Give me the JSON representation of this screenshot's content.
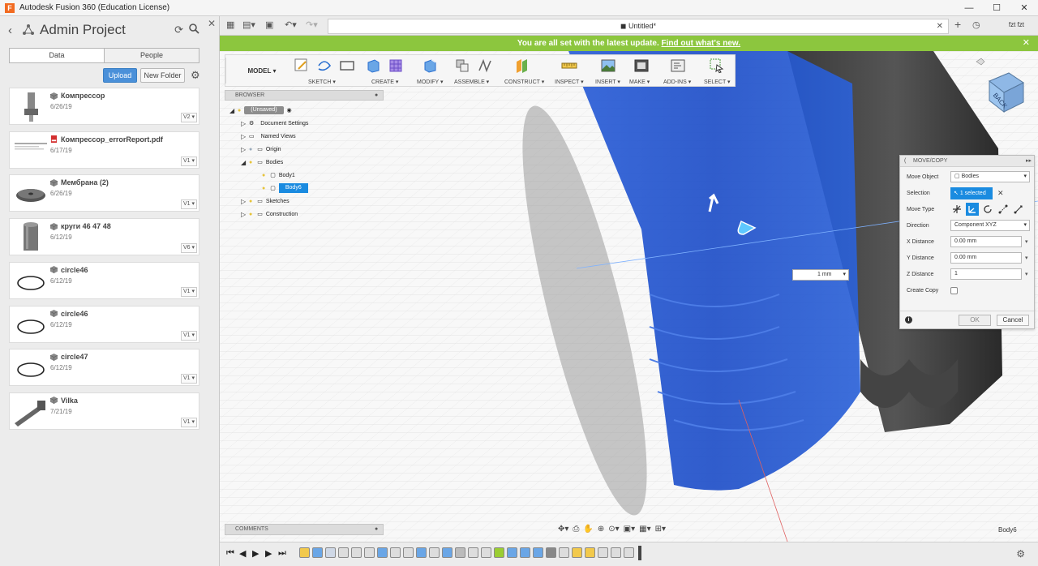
{
  "window": {
    "title": "Autodesk Fusion 360 (Education License)",
    "app_logo": "F",
    "controls": [
      "—",
      "☐",
      "✕"
    ]
  },
  "data_panel": {
    "project_title": "Admin Project",
    "close_glyph": "✕",
    "tabs": [
      {
        "label": "Data",
        "active": true
      },
      {
        "label": "People",
        "active": false
      }
    ],
    "upload_label": "Upload",
    "new_folder_label": "New Folder",
    "files": [
      {
        "name": "Компрессор",
        "date": "6/26/19",
        "version": "V2 ▾",
        "kind": "design",
        "thumb": "compressor"
      },
      {
        "name": "Компрессор_errorReport.pdf",
        "date": "6/17/19",
        "version": "V1 ▾",
        "kind": "pdf",
        "thumb": "report"
      },
      {
        "name": "Мембрана (2)",
        "date": "6/26/19",
        "version": "V1 ▾",
        "kind": "design",
        "thumb": "membrane"
      },
      {
        "name": "круги 46 47 48",
        "date": "6/12/19",
        "version": "V6 ▾",
        "kind": "design",
        "thumb": "cylinder"
      },
      {
        "name": "circle46",
        "date": "6/12/19",
        "version": "V1 ▾",
        "kind": "design",
        "thumb": "ring"
      },
      {
        "name": "circle46",
        "date": "6/12/19",
        "version": "V1 ▾",
        "kind": "design",
        "thumb": "ring"
      },
      {
        "name": "circle47",
        "date": "6/12/19",
        "version": "V1 ▾",
        "kind": "design",
        "thumb": "ring"
      },
      {
        "name": "Vilka",
        "date": "7/21/19",
        "version": "V1 ▾",
        "kind": "design",
        "thumb": "fork"
      }
    ]
  },
  "tabstrip": {
    "document_title": "Untitled*",
    "user": "fzt fzt"
  },
  "banner": {
    "message": "You are all set with the latest update.",
    "link": "Find out what's new.",
    "close_glyph": "✕"
  },
  "toolbar": {
    "workspace": "MODEL ▾",
    "groups": [
      {
        "label": "SKETCH ▾"
      },
      {
        "label": "CREATE ▾"
      },
      {
        "label": "MODIFY ▾"
      },
      {
        "label": "ASSEMBLE ▾"
      },
      {
        "label": "CONSTRUCT ▾"
      },
      {
        "label": "INSPECT ▾"
      },
      {
        "label": "INSERT ▾"
      },
      {
        "label": "MAKE ▾"
      },
      {
        "label": "ADD-INS ▾"
      },
      {
        "label": "SELECT ▾"
      }
    ]
  },
  "browser": {
    "header": "BROWSER",
    "root_label": "(Unsaved)",
    "items": [
      {
        "label": "Document Settings"
      },
      {
        "label": "Named Views"
      },
      {
        "label": "Origin"
      },
      {
        "label": "Bodies"
      },
      {
        "label": "Body1"
      },
      {
        "label": "Body6"
      },
      {
        "label": "Sketches"
      },
      {
        "label": "Construction"
      }
    ]
  },
  "comments_label": "COMMENTS",
  "selection_readout": "Body6",
  "viewcube_label": "BACK",
  "floating_distance": "1 mm",
  "move_copy": {
    "title": "MOVE/COPY",
    "move_object_label": "Move Object",
    "move_object_value": "Bodies",
    "selection_label": "Selection",
    "selection_value": "1 selected",
    "move_type_label": "Move Type",
    "direction_label": "Direction",
    "direction_value": "Component XYZ",
    "x_label": "X Distance",
    "x_value": "0.00 mm",
    "y_label": "Y Distance",
    "y_value": "0.00 mm",
    "z_label": "Z Distance",
    "z_value": "1",
    "create_copy_label": "Create Copy",
    "ok_label": "OK",
    "cancel_label": "Cancel"
  },
  "colors": {
    "banner": "#8cc63e",
    "selection_blue": "#1a8be0",
    "body_blue": "#1f4fc8",
    "upload_blue": "#4a90d9"
  }
}
